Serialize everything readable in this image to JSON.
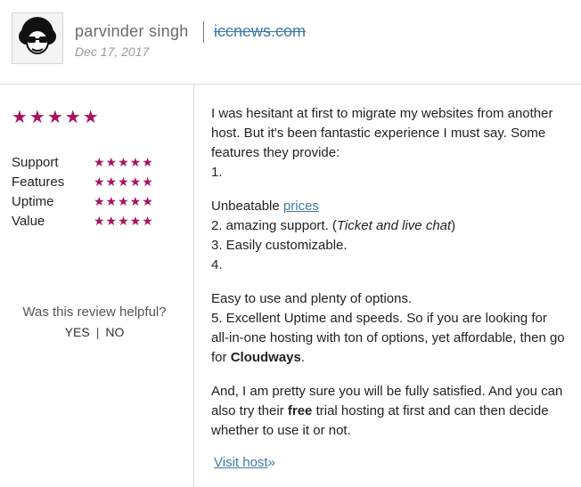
{
  "reviewer": {
    "name": "parvinder singh",
    "date": "Dec 17, 2017",
    "host_link": "iccnews.com"
  },
  "ratings": {
    "overall_stars": "★★★★★",
    "items": [
      {
        "label": "Support",
        "stars": "★★★★★"
      },
      {
        "label": "Features",
        "stars": "★★★★★"
      },
      {
        "label": "Uptime",
        "stars": "★★★★★"
      },
      {
        "label": "Value",
        "stars": "★★★★★"
      }
    ]
  },
  "helpful": {
    "question": "Was this review helpful?",
    "yes": "YES",
    "separator": "|",
    "no": "NO"
  },
  "review": {
    "p1_line1": "I was hesitant at first to migrate my websites from another host. But it's been fantastic experience I must say. Some features they provide:",
    "p1_line2": "1.",
    "p2_text_before_link": "Unbeatable ",
    "p2_link": "prices",
    "p2_line2_prefix": "2. amazing support. (",
    "p2_line2_italic": "Ticket and live chat",
    "p2_line2_suffix": ")",
    "p2_line3": "3. Easily customizable.",
    "p2_line4": "4.",
    "p3_line1": "Easy to use and plenty of options.",
    "p3_line2_prefix": "5. Excellent Uptime and speeds. So if you are looking for all-in-one hosting with ton of options, yet affordable, then go for ",
    "p3_line2_bold": "Cloudways",
    "p3_line2_suffix": ".",
    "p4_prefix": "And, I am pretty sure you will be fully satisfied. And you can also try their ",
    "p4_bold": "free",
    "p4_suffix": " trial hosting at first and can then decide whether to use it or not."
  },
  "visit_host": {
    "label": "Visit host",
    "arrow": "»"
  },
  "colors": {
    "star": "#a5145f",
    "link": "#3f7aa6"
  }
}
